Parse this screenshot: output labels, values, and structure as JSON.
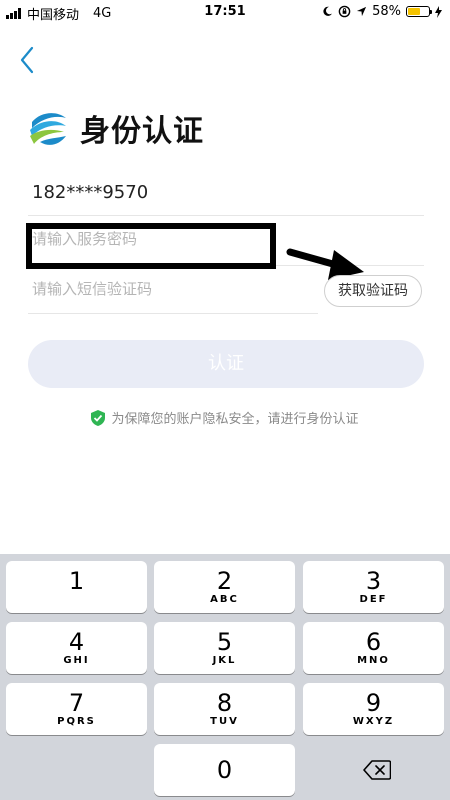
{
  "status_bar": {
    "carrier": "中国移动",
    "network": "4G",
    "time": "17:51",
    "battery": "58%",
    "battery_level": 0.58
  },
  "header": {
    "title": "身份认证",
    "logo_icon": "china-mobile-logo-icon"
  },
  "form": {
    "phone": "182****9570",
    "password_placeholder": "请输入服务密码",
    "sms_placeholder": "请输入短信验证码",
    "sms_button": "获取验证码",
    "submit_button": "认证"
  },
  "privacy_note": "为保障您的账户隐私安全，请进行身份认证",
  "colors": {
    "accent": "#1c8bc9",
    "submit_disabled": "#e9ecf6",
    "shield": "#2fb553"
  },
  "keypad": {
    "keys": [
      {
        "num": "1",
        "letters": ""
      },
      {
        "num": "2",
        "letters": "ABC"
      },
      {
        "num": "3",
        "letters": "DEF"
      },
      {
        "num": "4",
        "letters": "GHI"
      },
      {
        "num": "5",
        "letters": "JKL"
      },
      {
        "num": "6",
        "letters": "MNO"
      },
      {
        "num": "7",
        "letters": "PQRS"
      },
      {
        "num": "8",
        "letters": "TUV"
      },
      {
        "num": "9",
        "letters": "WXYZ"
      },
      {
        "num": "0",
        "letters": ""
      }
    ],
    "delete_icon": "backspace-icon"
  }
}
